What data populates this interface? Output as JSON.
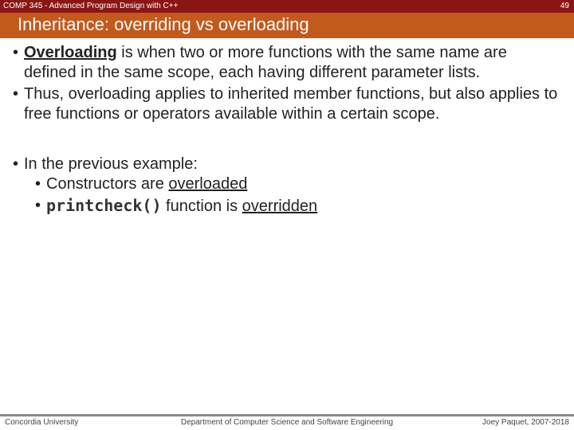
{
  "header": {
    "course": "COMP 345 - Advanced Program Design with C++",
    "page": "49",
    "title": "Inheritance: overriding vs overloading"
  },
  "body": {
    "overloading_label": "Overloading",
    "b1_rest": " is when two or more functions with the same name are defined in the same scope, each having different parameter lists.",
    "b2": "Thus, overloading applies to inherited member functions, but also applies to free functions or operators available within a certain scope.",
    "b3": "In the previous example:",
    "s1_pre": "Constructors are ",
    "s1_u": "overloaded",
    "s2_code": "printcheck()",
    "s2_mid": " function is ",
    "s2_u": "overridden"
  },
  "footer": {
    "left": "Concordia University",
    "center": "Department of Computer Science and Software Engineering",
    "right": "Joey Paquet, 2007-2018"
  }
}
